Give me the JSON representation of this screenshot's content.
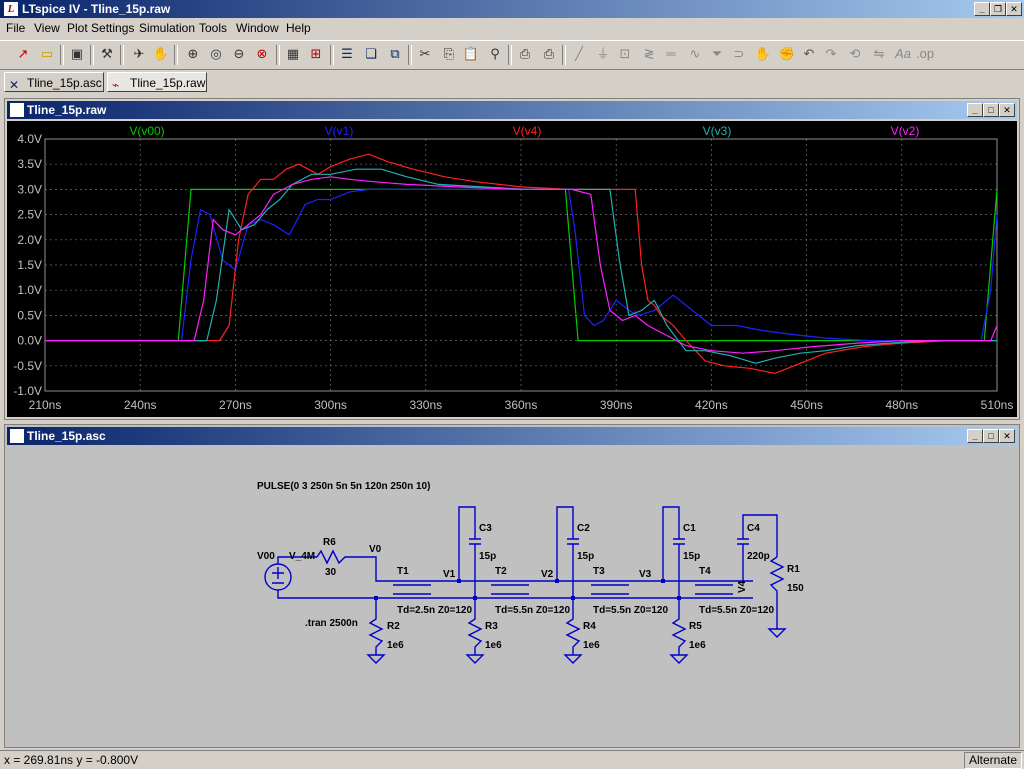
{
  "app": {
    "title": "LTspice IV - Tline_15p.raw"
  },
  "menu": [
    "File",
    "View",
    "Plot Settings",
    "Simulation",
    "Tools",
    "Window",
    "Help"
  ],
  "toolbar": {
    "icons": [
      "schematic-icon",
      "open-icon",
      "save-icon",
      "hammer-icon",
      "run-icon",
      "pan-icon",
      "zoom-in-icon",
      "zoom-area-icon",
      "zoom-out-icon",
      "zoom-cancel-icon",
      "autorange-icon",
      "grid-icon",
      "tile-icon",
      "cascade-icon",
      "close-all-icon",
      "cut-icon",
      "copy-icon",
      "paste-icon",
      "find-icon",
      "print-setup-icon",
      "print-icon",
      "wire-icon",
      "ground-icon",
      "label-icon",
      "resistor-icon",
      "capacitor-icon",
      "inductor-icon",
      "diode-icon",
      "move-icon",
      "drag-icon",
      "undo-icon",
      "redo-icon",
      "rotate-icon",
      "mirror-icon",
      "text-icon",
      "spice-directive-icon"
    ]
  },
  "tabs": [
    {
      "label": "Tline_15p.asc",
      "icon": "schematic-icon"
    },
    {
      "label": "Tline_15p.raw",
      "icon": "waveform-icon"
    }
  ],
  "waveform_window": {
    "title": "Tline_15p.raw"
  },
  "schematic_window": {
    "title": "Tline_15p.asc"
  },
  "chart_data": {
    "type": "line",
    "xlabel": "",
    "ylabel": "",
    "xlim": [
      210,
      510
    ],
    "ylim": [
      -1.0,
      4.0
    ],
    "x_ticks": [
      "210ns",
      "240ns",
      "270ns",
      "300ns",
      "330ns",
      "360ns",
      "390ns",
      "420ns",
      "450ns",
      "480ns",
      "510ns"
    ],
    "y_ticks": [
      "4.0V",
      "3.5V",
      "3.0V",
      "2.5V",
      "2.0V",
      "1.5V",
      "1.0V",
      "0.5V",
      "0.0V",
      "-0.5V",
      "-1.0V"
    ],
    "grid": true,
    "legend": "top",
    "series": [
      {
        "name": "V(v00)",
        "color": "#00cc00",
        "points": [
          [
            210,
            0
          ],
          [
            252,
            0
          ],
          [
            256,
            3
          ],
          [
            374,
            3
          ],
          [
            378,
            0
          ],
          [
            506,
            0
          ],
          [
            510,
            3
          ]
        ]
      },
      {
        "name": "V(v1)",
        "color": "#2020ff",
        "points": [
          [
            210,
            0
          ],
          [
            253,
            0
          ],
          [
            256,
            1.6
          ],
          [
            259,
            2.6
          ],
          [
            262,
            2.5
          ],
          [
            266,
            1.6
          ],
          [
            270,
            1.4
          ],
          [
            274,
            2.3
          ],
          [
            278,
            2.4
          ],
          [
            282,
            2.3
          ],
          [
            287,
            2.1
          ],
          [
            292,
            2.7
          ],
          [
            296,
            2.8
          ],
          [
            300,
            2.8
          ],
          [
            306,
            2.95
          ],
          [
            312,
            3.0
          ],
          [
            340,
            3.0
          ],
          [
            372,
            3.0
          ],
          [
            375,
            3.0
          ],
          [
            377,
            2.2
          ],
          [
            380,
            0.5
          ],
          [
            383,
            0.3
          ],
          [
            386,
            0.4
          ],
          [
            390,
            0.8
          ],
          [
            394,
            0.6
          ],
          [
            397,
            0.5
          ],
          [
            402,
            0.6
          ],
          [
            408,
            0.9
          ],
          [
            414,
            0.6
          ],
          [
            420,
            0.3
          ],
          [
            428,
            0.3
          ],
          [
            436,
            0.2
          ],
          [
            446,
            0.12
          ],
          [
            456,
            0.05
          ],
          [
            470,
            0.0
          ],
          [
            480,
            0.0
          ],
          [
            505,
            0.0
          ],
          [
            508,
            1.0
          ],
          [
            510,
            2.5
          ]
        ]
      },
      {
        "name": "V(v4)",
        "color": "#ff2020",
        "points": [
          [
            210,
            0
          ],
          [
            265,
            0
          ],
          [
            268,
            0.3
          ],
          [
            271,
            2.0
          ],
          [
            274,
            2.9
          ],
          [
            278,
            3.2
          ],
          [
            282,
            3.2
          ],
          [
            286,
            3.4
          ],
          [
            290,
            3.5
          ],
          [
            296,
            3.3
          ],
          [
            300,
            3.45
          ],
          [
            306,
            3.6
          ],
          [
            312,
            3.7
          ],
          [
            318,
            3.55
          ],
          [
            326,
            3.4
          ],
          [
            336,
            3.25
          ],
          [
            346,
            3.15
          ],
          [
            360,
            3.05
          ],
          [
            375,
            3.0
          ],
          [
            396,
            3.0
          ],
          [
            398,
            1.5
          ],
          [
            400,
            0.8
          ],
          [
            402,
            0.7
          ],
          [
            404,
            0.5
          ],
          [
            408,
            0.3
          ],
          [
            412,
            0.0
          ],
          [
            418,
            -0.4
          ],
          [
            424,
            -0.5
          ],
          [
            432,
            -0.55
          ],
          [
            440,
            -0.65
          ],
          [
            448,
            -0.45
          ],
          [
            456,
            -0.25
          ],
          [
            468,
            -0.12
          ],
          [
            480,
            -0.05
          ],
          [
            495,
            0.0
          ],
          [
            510,
            0.0
          ]
        ]
      },
      {
        "name": "V(v3)",
        "color": "#20b0b0",
        "points": [
          [
            210,
            0
          ],
          [
            261,
            0
          ],
          [
            264,
            0.8
          ],
          [
            268,
            2.6
          ],
          [
            272,
            2.2
          ],
          [
            276,
            2.3
          ],
          [
            280,
            2.6
          ],
          [
            284,
            2.8
          ],
          [
            288,
            3.1
          ],
          [
            294,
            3.3
          ],
          [
            300,
            3.3
          ],
          [
            308,
            3.4
          ],
          [
            316,
            3.4
          ],
          [
            324,
            3.25
          ],
          [
            334,
            3.1
          ],
          [
            348,
            3.05
          ],
          [
            362,
            3.0
          ],
          [
            378,
            3.0
          ],
          [
            388,
            3.0
          ],
          [
            391,
            1.6
          ],
          [
            394,
            0.5
          ],
          [
            398,
            0.6
          ],
          [
            402,
            0.8
          ],
          [
            406,
            0.3
          ],
          [
            412,
            -0.2
          ],
          [
            418,
            -0.2
          ],
          [
            426,
            -0.3
          ],
          [
            434,
            -0.45
          ],
          [
            440,
            -0.35
          ],
          [
            448,
            -0.25
          ],
          [
            456,
            -0.2
          ],
          [
            466,
            -0.1
          ],
          [
            476,
            -0.05
          ],
          [
            490,
            0.0
          ],
          [
            510,
            0.0
          ]
        ]
      },
      {
        "name": "V(v2)",
        "color": "#ff20ff",
        "points": [
          [
            210,
            0
          ],
          [
            257,
            0
          ],
          [
            260,
            0.8
          ],
          [
            263,
            2.4
          ],
          [
            266,
            2.2
          ],
          [
            270,
            2.1
          ],
          [
            274,
            2.3
          ],
          [
            278,
            2.5
          ],
          [
            282,
            2.9
          ],
          [
            288,
            3.1
          ],
          [
            294,
            3.2
          ],
          [
            300,
            3.25
          ],
          [
            306,
            3.2
          ],
          [
            314,
            3.15
          ],
          [
            324,
            3.1
          ],
          [
            340,
            3.05
          ],
          [
            360,
            3.0
          ],
          [
            376,
            3.0
          ],
          [
            382,
            2.9
          ],
          [
            385,
            1.5
          ],
          [
            388,
            0.6
          ],
          [
            392,
            0.4
          ],
          [
            396,
            0.5
          ],
          [
            400,
            0.3
          ],
          [
            406,
            0.1
          ],
          [
            412,
            -0.1
          ],
          [
            420,
            -0.2
          ],
          [
            430,
            -0.25
          ],
          [
            440,
            -0.2
          ],
          [
            452,
            -0.12
          ],
          [
            466,
            -0.05
          ],
          [
            480,
            0.0
          ],
          [
            500,
            0.0
          ],
          [
            508,
            0.0
          ],
          [
            510,
            0.3
          ]
        ]
      }
    ]
  },
  "schematic": {
    "source_text": "PULSE(0 3 250n 5n 5n 120n 250n 10)",
    "source_name": "V00",
    "source_node": "V_4M",
    "r6": {
      "name": "R6",
      "value": "30"
    },
    "v0": "V0",
    "tline_labels": [
      {
        "name": "T1",
        "param": "Td=2.5n Z0=120"
      },
      {
        "name": "T2",
        "param": "Td=5.5n Z0=120"
      },
      {
        "name": "T3",
        "param": "Td=5.5n Z0=120"
      },
      {
        "name": "T4",
        "param": "Td=5.5n Z0=120"
      }
    ],
    "nodes": [
      "V1",
      "V2",
      "V3",
      "V4"
    ],
    "caps": [
      {
        "name": "C3",
        "value": "15p"
      },
      {
        "name": "C2",
        "value": "15p"
      },
      {
        "name": "C1",
        "value": "15p"
      },
      {
        "name": "C4",
        "value": "220p"
      }
    ],
    "resistors": [
      {
        "name": "R2",
        "value": "1e6"
      },
      {
        "name": "R3",
        "value": "1e6"
      },
      {
        "name": "R4",
        "value": "1e6"
      },
      {
        "name": "R5",
        "value": "1e6"
      }
    ],
    "r1": {
      "name": "R1",
      "value": "150"
    },
    "directive": ".tran 2500n"
  },
  "status": {
    "coords": "x = 269.81ns    y = -0.800V",
    "mode": "Alternate"
  }
}
